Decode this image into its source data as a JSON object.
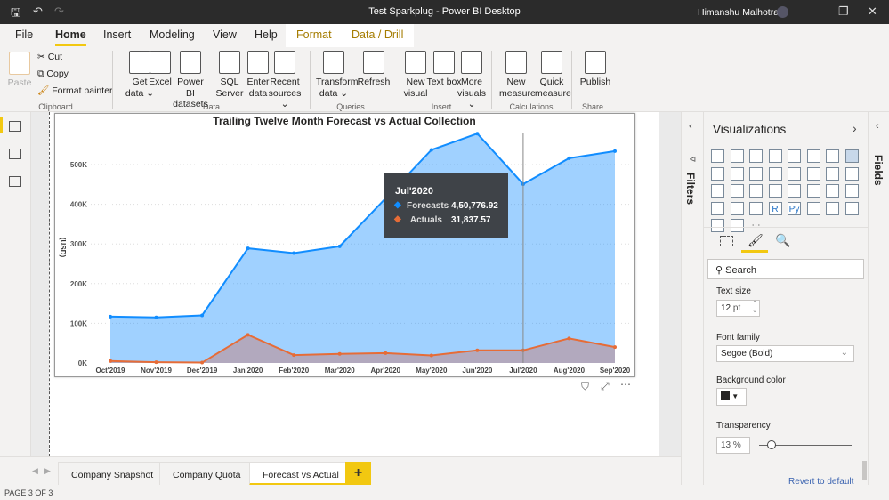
{
  "window": {
    "title": "Test Sparkplug - Power BI Desktop",
    "user": "Himanshu Malhotra"
  },
  "menu_tabs": [
    "File",
    "Home",
    "Insert",
    "Modeling",
    "View",
    "Help"
  ],
  "context_tabs": [
    "Format",
    "Data / Drill"
  ],
  "ribbon": {
    "clipboard": {
      "paste": "Paste",
      "cut": "Cut",
      "copy": "Copy",
      "format_painter": "Format painter",
      "group": "Clipboard"
    },
    "data": {
      "items": [
        "Get data ⌄",
        "Excel",
        "Power BI datasets",
        "SQL Server",
        "Enter data",
        "Recent sources ⌄"
      ],
      "group": "Data"
    },
    "queries": {
      "items": [
        "Transform data ⌄",
        "Refresh"
      ],
      "group": "Queries"
    },
    "insert": {
      "items": [
        "New visual",
        "Text box",
        "More visuals ⌄"
      ],
      "group": "Insert"
    },
    "calculations": {
      "items": [
        "New measure",
        "Quick measure"
      ],
      "group": "Calculations"
    },
    "share": {
      "items": [
        "Publish"
      ],
      "group": "Share"
    }
  },
  "filters_label": "Filters",
  "fields_label": "Fields",
  "visualizations": {
    "title": "Visualizations",
    "search_placeholder": "Search",
    "text_size_label": "Text size",
    "text_size": "12",
    "text_size_unit": "pt",
    "font_family_label": "Font family",
    "font_family": "Segoe (Bold)",
    "bg_color_label": "Background color",
    "bg_color": "#252423",
    "transparency_label": "Transparency",
    "transparency": "13",
    "transparency_unit": "%",
    "transparency_pct": 13,
    "revert": "Revert to default",
    "icons": [
      "stacked-bar",
      "stacked-column",
      "clustered-bar",
      "clustered-column",
      "100-bar",
      "100-column",
      "line",
      "area",
      "stacked-area",
      "line-column",
      "line-clustered",
      "ribbon",
      "waterfall",
      "funnel",
      "scatter",
      "pie",
      "donut",
      "treemap",
      "map",
      "filled-map",
      "gauge",
      "card",
      "multi-row-card",
      "kpi",
      "slicer",
      "table",
      "matrix",
      "r-visual",
      "python-visual",
      "key-influencers",
      "decomposition-tree",
      "qa",
      "power-apps",
      "paginated",
      "more"
    ]
  },
  "chart_data": {
    "type": "area",
    "title": "Trailing Twelve Month Forecast vs Actual Collection",
    "xlabel": "",
    "ylabel": "(USD)",
    "categories": [
      "Oct'2019",
      "Nov'2019",
      "Dec'2019",
      "Jan'2020",
      "Feb'2020",
      "Mar'2020",
      "Apr'2020",
      "May'2020",
      "Jun'2020",
      "Jul'2020",
      "Aug'2020",
      "Sep'2020"
    ],
    "yticks": [
      "0K",
      "100K",
      "200K",
      "300K",
      "400K",
      "500K"
    ],
    "ylim": [
      0,
      600000
    ],
    "grid": true,
    "series": [
      {
        "name": "Forecasts",
        "color": "#118dff",
        "values": [
          117000,
          115000,
          120000,
          289000,
          277000,
          294000,
          415000,
          537000,
          578000,
          450776.92,
          516000,
          534000
        ]
      },
      {
        "name": "Actuals",
        "color": "#e66c37",
        "values": [
          5000,
          2000,
          1000,
          71000,
          20000,
          23000,
          25000,
          19000,
          32000,
          31837.57,
          62000,
          40000
        ]
      }
    ],
    "tooltip": {
      "category": "Jul'2020",
      "rows": [
        {
          "name": "Forecasts",
          "value": "4,50,776.92"
        },
        {
          "name": "Actuals",
          "value": "31,837.57"
        }
      ]
    }
  },
  "page_tabs": [
    "Company Snapshot",
    "Company Quota",
    "Forecast vs Actual"
  ],
  "active_page": "Forecast vs Actual",
  "add_page": "+",
  "status": "PAGE 3 OF 3"
}
